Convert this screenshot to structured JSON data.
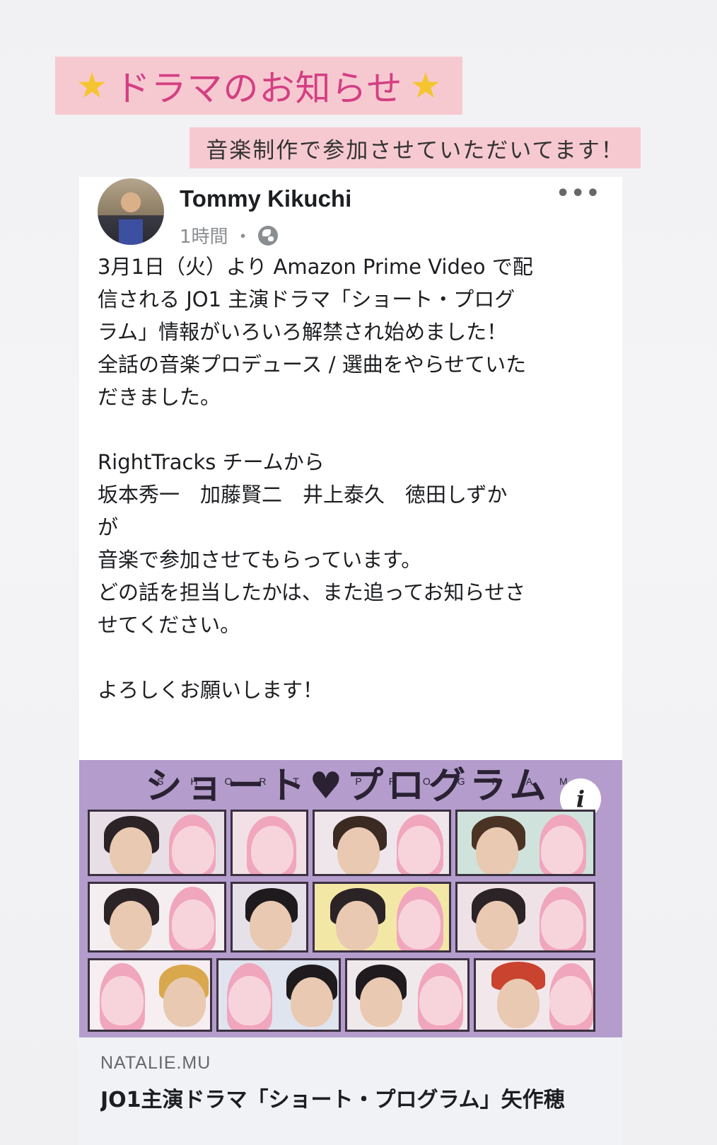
{
  "story": {
    "title_sticker": "ドラマのお知らせ",
    "star_icon": "star-icon",
    "subtitle_sticker": "音楽制作で参加させていただいてます！",
    "accent_color": "#d43f83",
    "sticker_bg": "#f6c9d0"
  },
  "post": {
    "author": "Tommy Kikuchi",
    "time": "1時間",
    "separator": "・",
    "audience_icon": "globe-icon",
    "more_icon": "more-icon",
    "body": "3月1日（火）より Amazon Prime Video で配\n信される JO1 主演ドラマ「ショート・プログ\nラム」情報がいろいろ解禁され始めました！\n全話の音楽プロデュース / 選曲をやらせていた\nだきました。\n\nRightTracks チームから\n坂本秀一　加藤賢二　井上泰久　徳田しずか\nが\n音楽で参加させてもらっています。\nどの話を担当したかは、また追ってお知らせさ\nせてください。\n\nよろしくお願いします！"
  },
  "link_preview": {
    "image_title": "ショート♥プログラム",
    "image_subtitle": "SHORT PROGRAM",
    "info_icon": "i",
    "domain": "NATALIE.MU",
    "headline": "JO1主演ドラマ「ショート・プログラム」矢作穂"
  }
}
